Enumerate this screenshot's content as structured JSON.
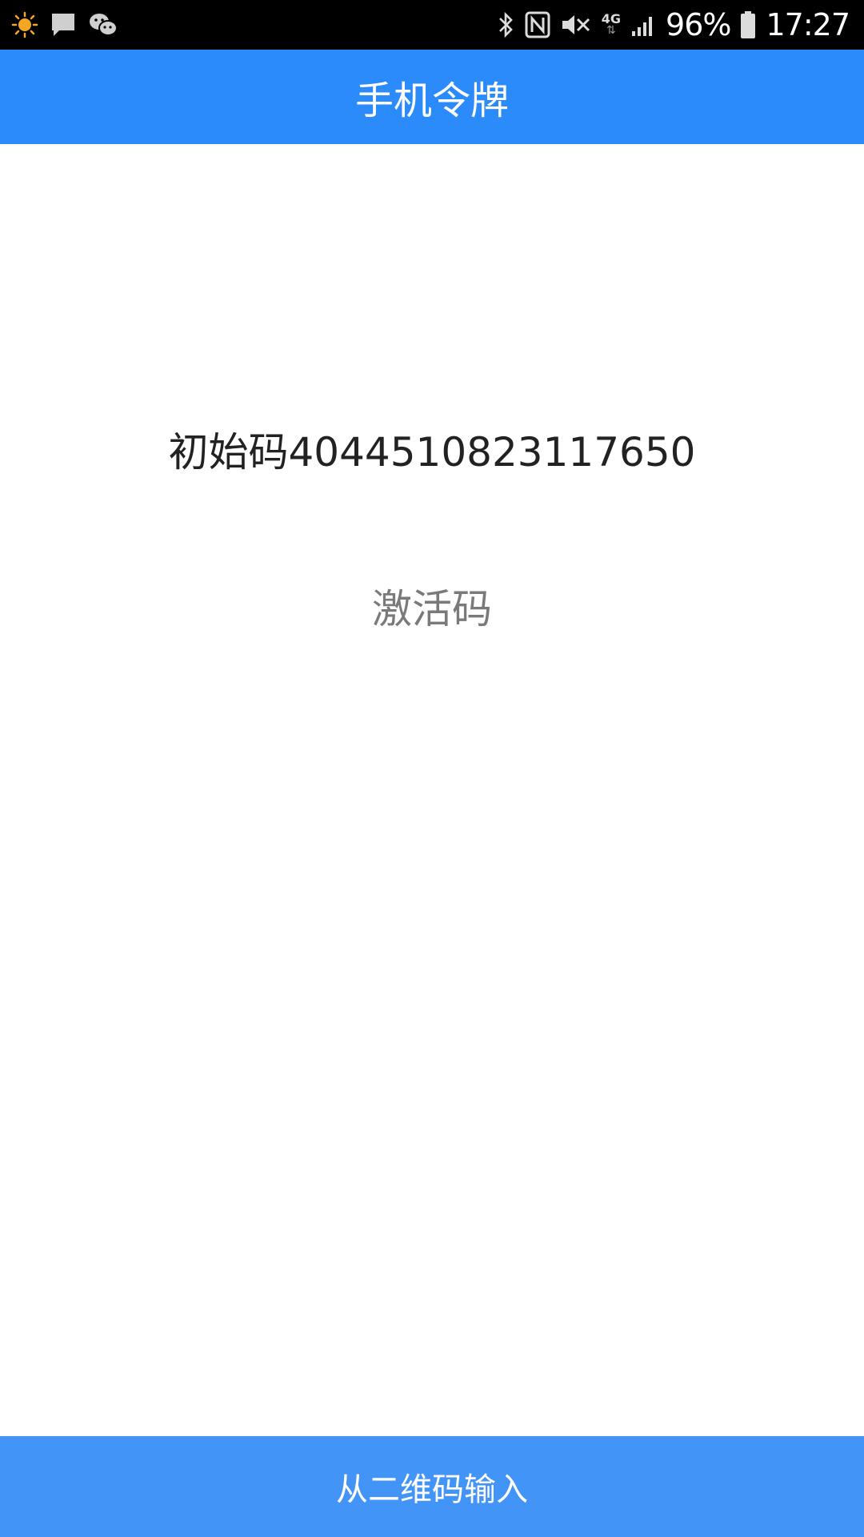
{
  "status_bar": {
    "battery_percent": "96%",
    "time": "17:27",
    "network_type": "4G",
    "icons": [
      "weather-sun-icon",
      "message-icon",
      "wechat-icon",
      "bluetooth-icon",
      "nfc-icon",
      "vibrate-mute-icon",
      "network-4g-icon",
      "signal-icon",
      "battery-icon"
    ],
    "accent_sun": "#f5a623"
  },
  "app_bar": {
    "title": "手机令牌",
    "background": "#2b8bfb"
  },
  "content": {
    "initial_code_text": "初始码4044510823117650",
    "activation_placeholder": "激活码"
  },
  "bottom_button": {
    "label": "从二维码输入",
    "background": "#4294f6"
  }
}
